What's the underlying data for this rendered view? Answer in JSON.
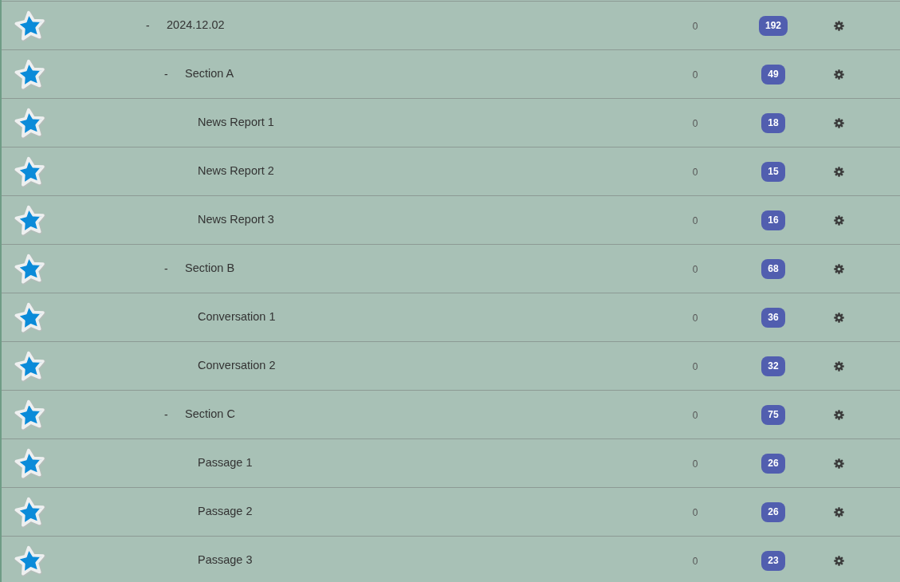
{
  "decks": [
    {
      "name": "2024.12.02",
      "toggle": "-",
      "count": "0",
      "badge": "192",
      "children": [
        {
          "name": "Section A",
          "toggle": "-",
          "count": "0",
          "badge": "49",
          "children": [
            {
              "name": "News Report 1",
              "count": "0",
              "badge": "18"
            },
            {
              "name": "News Report 2",
              "count": "0",
              "badge": "15"
            },
            {
              "name": "News Report 3",
              "count": "0",
              "badge": "16"
            }
          ]
        },
        {
          "name": "Section B",
          "toggle": "-",
          "count": "0",
          "badge": "68",
          "children": [
            {
              "name": "Conversation 1",
              "count": "0",
              "badge": "36"
            },
            {
              "name": "Conversation 2",
              "count": "0",
              "badge": "32"
            }
          ]
        },
        {
          "name": "Section C",
          "toggle": "-",
          "count": "0",
          "badge": "75",
          "children": [
            {
              "name": "Passage 1",
              "count": "0",
              "badge": "26"
            },
            {
              "name": "Passage 2",
              "count": "0",
              "badge": "26"
            },
            {
              "name": "Passage 3",
              "count": "0",
              "badge": "23"
            }
          ]
        }
      ]
    }
  ]
}
